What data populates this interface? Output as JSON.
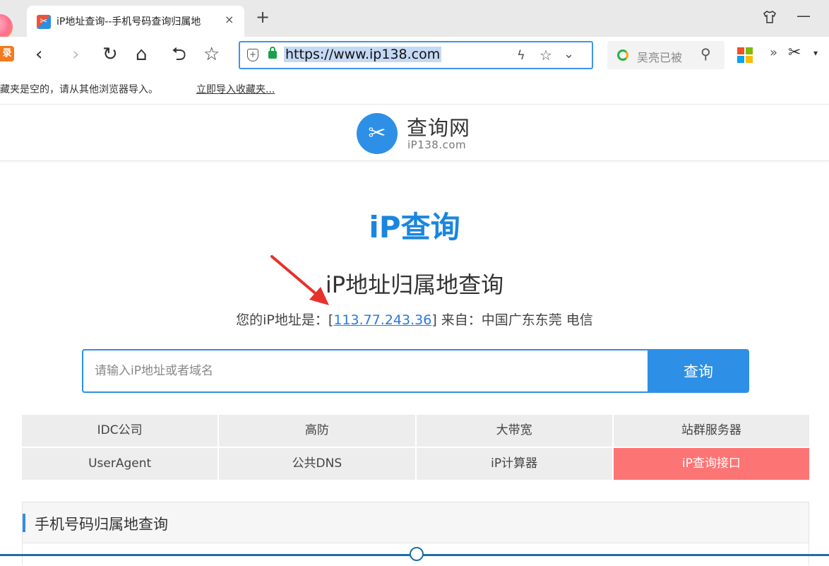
{
  "browser": {
    "tab": {
      "title": "iP地址查询--手机号码查询归属地",
      "close_glyph": "×"
    },
    "new_tab_glyph": "+",
    "login_badge": "录",
    "toolbar": {
      "back": "‹",
      "forward": "›",
      "refresh": "↻",
      "home": "⌂",
      "undo": "⮌",
      "star": "☆"
    },
    "url": "https://www.ip138.com",
    "url_bolt": "ϟ",
    "url_star": "☆",
    "url_chevron": "⌄",
    "search_placeholder": "吴亮已被",
    "search_magnifier": "⚲",
    "more": "»",
    "scissors": "✂",
    "dropdown": "▾",
    "minimize": "—",
    "shirt": "👕",
    "apps_colors": [
      "#f25022",
      "#7fba00",
      "#00a4ef",
      "#ffb900"
    ]
  },
  "bookmarks": {
    "message": "藏夹是空的，请从其他浏览器导入。",
    "import_link": "立即导入收藏夹..."
  },
  "site": {
    "logo_glyph": "✂",
    "logo_title": "查询网",
    "logo_domain": "iP138.com"
  },
  "main": {
    "hero_title": "iP查询",
    "hero_subtitle": "iP地址归属地查询",
    "ip_prefix": "您的iP地址是：[",
    "ip_address": "113.77.243.36",
    "ip_suffix": "] 来自：中国广东东莞 电信",
    "query_placeholder": "请输入iP地址或者域名",
    "query_button": "查询",
    "quick_links": [
      "IDC公司",
      "高防",
      "大带宽",
      "站群服务器",
      "UserAgent",
      "公共DNS",
      "iP计算器",
      "iP查询接口"
    ],
    "phone_section_title": "手机号码归属地查询"
  },
  "colors": {
    "accent": "#2e8fe6",
    "hot_link": "#fd7474",
    "arrow": "#e8302a"
  }
}
